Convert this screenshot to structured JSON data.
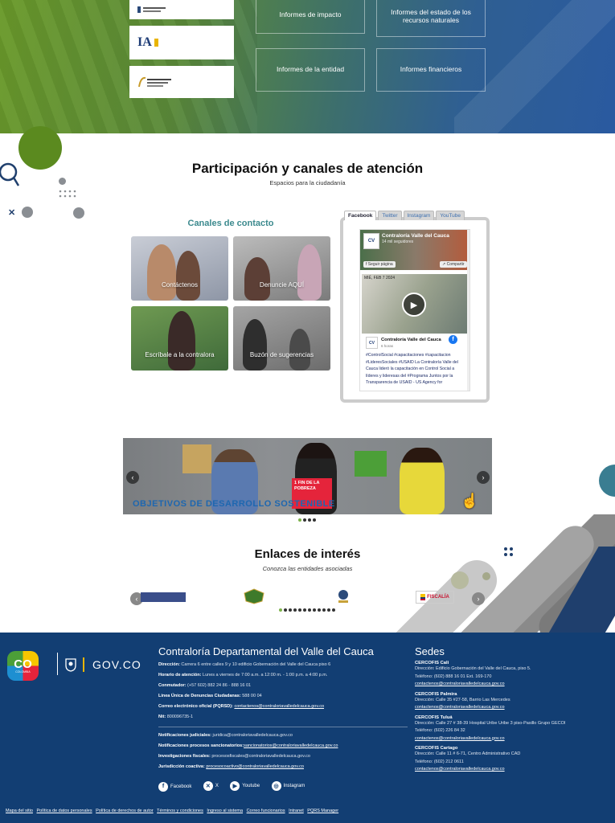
{
  "reports": {
    "impact": "Informes de impacto",
    "natural_resources": "Informes del estado de los recursos naturales",
    "entity": "Informes de la entidad",
    "financial": "Informes financieros"
  },
  "logos": [
    "IA"
  ],
  "participation": {
    "title": "Participación y canales de atención",
    "subtitle": "Espacios para la ciudadanía",
    "contact_title": "Canales de contacto",
    "cards": [
      "Contáctenos",
      "Denuncie AQUÍ",
      "Escríbale a la contralora",
      "Buzón de sugerencias"
    ]
  },
  "social_tabs": [
    "Facebook",
    "Twitter",
    "Instagram",
    "YouTube"
  ],
  "fb_post": {
    "page_name": "Contraloría Valle del Cauca",
    "followers": "14 mil seguidores",
    "follow_label": "Seguir página",
    "share_label": "Compartir",
    "video_date": "MIÉ, FEB 7 2024",
    "author": "Contraloría Valle del Cauca",
    "time": "6 horas",
    "text": "#ControlSocial #capacitaciones #capacitacion #LideresSociales #USAID La Contraloría Valle del Cauca lideró la capacitación en Control Social a líderes y lideresas del #Programa Juntos por la Transparencia de USAID - US Agency for"
  },
  "banner": {
    "text": "OBJETIVOS DE DESARROLLO SOSTENIBLE",
    "goal1": "1 FIN DE LA POBREZA"
  },
  "links": {
    "title": "Enlaces de interés",
    "subtitle": "Conozca las entidades asociadas",
    "items": [
      "FISCALÍA"
    ]
  },
  "footer": {
    "entity": "Contraloría Departamental del Valle del Cauca",
    "gov": "GOV.CO",
    "co": "CO",
    "co_sub": "COLOMBIA",
    "lines": [
      {
        "label": "Dirección:",
        "value": " Carrera 6 entre calles 9 y 10 edificio Gobernación del Valle del Cauca piso 6"
      },
      {
        "label": "Horario de atención:",
        "value": " Lunes a viernes de 7:00 a.m. a 12:00 m. - 1:00 p.m. a 4:00 p.m."
      },
      {
        "label": "Conmutador:",
        "value": " (+57 602) 882 24 86 - 888 16 01"
      },
      {
        "label": "Línea Única de Denuncias Ciudadanas:",
        "value": " 588 00 04"
      },
      {
        "label": "Correo electrónico oficial (PQRSD):",
        "value": "contactenos@contraloriavalledelcauca.gov.co"
      },
      {
        "label": "Nit:",
        "value": " 800096735-1"
      }
    ],
    "lines2": [
      {
        "label": "Notificaciones judiciales:",
        "value": " juridica@contraloriavalledelcauca.gov.co"
      },
      {
        "label": "Notificaciones procesos sancionatorios:",
        "value": "sancionatorios@contraloriavalledelcauca.gov.co"
      },
      {
        "label": "Investigaciones fiscales:",
        "value": " procesosfiscales@contraloriavalledelcauca.gov.co"
      },
      {
        "label": "Jurisdicción coactiva:",
        "value": " procesocoactivo@contraloriavalledelcauca.gov.co"
      }
    ],
    "social": [
      "Facebook",
      "X",
      "Youtube",
      "Instagram"
    ],
    "sedes_title": "Sedes",
    "sedes": [
      {
        "name": "CERCOFIS Cali",
        "lines": [
          "Dirección: Edificio Gobernación del Valle del Cauca, piso 5.",
          "Teléfono: (602) 888 16 01 Ext. 169-170"
        ],
        "email": "contactenos@contraloriavalledelcauca.gov.co"
      },
      {
        "name": "CERCOFIS Palmira",
        "lines": [
          "Dirección: Calle 35 #27-58, Barrio Las Mercedes"
        ],
        "email": "contactenos@contraloriavalledelcauca.gov.co"
      },
      {
        "name": "CERCOFIS Tuluá",
        "lines": [
          "Dirección: Calle 27 # 38-39 Hospital Uribe Uribe 3 piso-Pasillo Grupo GECOI",
          "Teléfono: (602) 226 84 32"
        ],
        "email": "contactenos@contraloriavalledelcauca.gov.co"
      },
      {
        "name": "CERCOFIS Cartago",
        "lines": [
          "Dirección: Calle 11 # 6-71, Centro Administrativo CAD",
          "Teléfono: (602) 212 0611"
        ],
        "email": "contactenos@contraloriavalledelcauca.gov.co"
      }
    ],
    "legal": [
      "Mapa del sitio",
      "Política de datos personales",
      "Política de derechos de autor",
      "Términos y condiciones",
      "Ingreso al sistema",
      "Correo funcionarios",
      "Intranet",
      "PQRS Manager"
    ]
  }
}
